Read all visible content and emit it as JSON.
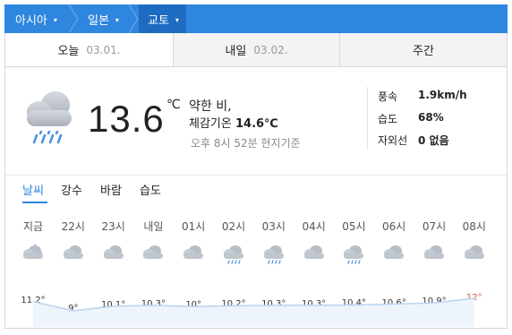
{
  "breadcrumb": [
    {
      "label": "아시아",
      "caret": "▾"
    },
    {
      "label": "일본",
      "caret": "▾"
    },
    {
      "label": "교토",
      "caret": "▾"
    }
  ],
  "date_tabs": [
    {
      "label": "오늘",
      "date": "03.01."
    },
    {
      "label": "내일",
      "date": "03.02."
    },
    {
      "label": "주간",
      "date": ""
    }
  ],
  "current": {
    "icon": "rain-cloud-icon",
    "temperature": "13.6",
    "unit": "℃",
    "condition": "약한 비,",
    "feels_label": "체감기온",
    "feels_value": "14.6℃",
    "observed": "오후 8시 52분 현지기준"
  },
  "stats": [
    {
      "label": "풍속",
      "value": "1.9km/h"
    },
    {
      "label": "습도",
      "value": "68%"
    },
    {
      "label": "자외선",
      "value": "0 없음"
    }
  ],
  "sub_tabs": [
    "날씨",
    "강수",
    "바람",
    "습도"
  ],
  "hourly": [
    {
      "time": "지금",
      "icon": "cloud-moon-icon",
      "temp": "11.2°"
    },
    {
      "time": "22시",
      "icon": "cloud-icon",
      "temp": "9°"
    },
    {
      "time": "23시",
      "icon": "cloud-icon",
      "temp": "10.1°"
    },
    {
      "time": "내일",
      "icon": "cloud-icon",
      "temp": "10.3°"
    },
    {
      "time": "01시",
      "icon": "cloud-icon",
      "temp": "10°"
    },
    {
      "time": "02시",
      "icon": "rain-cloud-icon",
      "temp": "10.2°"
    },
    {
      "time": "03시",
      "icon": "rain-cloud-icon",
      "temp": "10.3°"
    },
    {
      "time": "04시",
      "icon": "cloud-icon",
      "temp": "10.3°"
    },
    {
      "time": "05시",
      "icon": "rain-cloud-icon",
      "temp": "10.4°"
    },
    {
      "time": "06시",
      "icon": "cloud-icon",
      "temp": "10.6°"
    },
    {
      "time": "07시",
      "icon": "cloud-icon",
      "temp": "10.9°"
    },
    {
      "time": "08시",
      "icon": "cloud-icon",
      "temp": "12°"
    }
  ],
  "colors": {
    "accent": "#2f86de",
    "hot": "#e05050",
    "graph_line": "#b9d3ef"
  }
}
